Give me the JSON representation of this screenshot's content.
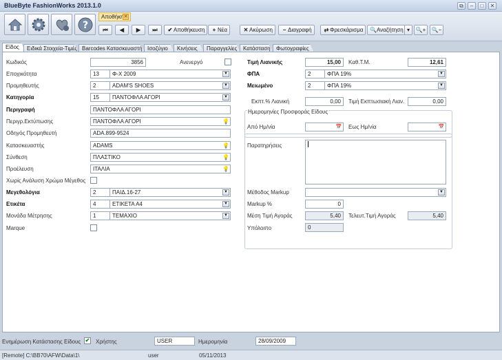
{
  "window": {
    "title": "BlueByte FashionWorks 2013.1.0"
  },
  "document_tab": {
    "label": "Αποθήκη"
  },
  "toolbar": {
    "save": "Αποθήκευση",
    "new": "Νέα",
    "cancel": "Ακύρωση",
    "delete": "Διαγραφή",
    "refresh": "Φρεσκάρισμα",
    "search": "Αναζήτηση"
  },
  "tabs": [
    "Είδος",
    "Ειδικά Στοιχεία-Τιμές",
    "Barcodes Κατασκευαστή",
    "Ισοζύγιο",
    "Κινήσεις",
    "Παραγγελίες",
    "Κατάσταση",
    "Φωτογραφίες"
  ],
  "form": {
    "code_label": "Κωδικός",
    "code": "3856",
    "inactive_label": "Ανενεργό",
    "season_label": "Εποχικότητα",
    "season_code": "13",
    "season_name": "Φ-Χ 2009",
    "supplier_label": "Προμηθευτής",
    "supplier_code": "2",
    "supplier_name": "ADAM'S SHOES",
    "category_label": "Κατηγορία",
    "category_code": "15",
    "category_name": "ΠΑΝΤΟΦΛΑ ΑΓΟΡΙ",
    "description_label": "Περιγραφή",
    "description": "ΠΑΝΤΟΦΛΑ ΑΓΟΡΙ",
    "print_desc_label": "Περιγρ.Εκτύπωσης",
    "print_desc": "ΠΑΝΤΟΦΛΑ ΑΓΟΡΙ",
    "supplier_code_label": "Οδηγός Προμηθευτή",
    "supplier_ref": "ADA.899-9524",
    "manufacturer_label": "Κατασκευαστής",
    "manufacturer": "ADAMS",
    "composition_label": "Σύνθεση",
    "composition": "ΠΛΑΣΤΙΚΟ",
    "origin_label": "Προέλευση",
    "origin": "ΙΤΑΛΙΑ",
    "no_color_size_label": "Χωρίς Ανάλυση Χρώμα Μέγεθος",
    "size_range_label": "Μεγεθολόγια",
    "size_range_code": "2",
    "size_range_name": "ΠΑΙΔ.16-27",
    "label_label": "Ετικέτα",
    "label_code": "4",
    "label_name": "ΕΤΙΚΕΤΑ Α4",
    "unit_label": "Μονάδα Μέτρησης",
    "unit_code": "1",
    "unit_name": "ΤΕΜΑΧΙΟ",
    "marque_label": "Marque",
    "retail_price_label": "Τιμή Λιανικής",
    "retail_price": "15,00",
    "net_cost_label": "Καθ.Τ.Μ.",
    "net_cost": "12,61",
    "vat_label": "ΦΠΑ",
    "vat_code": "2",
    "vat_name": "ΦΠΑ 19%",
    "reduced_label": "Μειωμένο",
    "reduced_code": "2",
    "reduced_name": "ΦΠΑ 19%",
    "discount_label": "Εκπτ.% Λιανική",
    "discount": "0,00",
    "discount_price_label": "Τιμή Εκπτωσιακή Λιαν.",
    "discount_price": "0,00",
    "offer_dates_label": "Ημερομηνίες Προσφοράς Είδους",
    "from_label": "Από Ημ/νία",
    "to_label": "Εως Ημ/νία",
    "notes_label": "Παρατηρήσεις",
    "markup_method_label": "Μέθοδος Markup",
    "markup_pct_label": "Markup %",
    "markup_pct": "0",
    "avg_cost_label": "Μέση Τιμή Αγοράς",
    "avg_cost": "5,40",
    "last_cost_label": "Τελευτ.Τιμή Αγοράς",
    "last_cost": "5,40",
    "balance_label": "Υπόλοιπο",
    "balance": "0"
  },
  "bottom": {
    "update_status_label": "Ενημέρωση Κατάστασης Είδους",
    "user_label": "Χρήστης",
    "user": "USER",
    "date_label": "Ημερομηνία",
    "date": "28/09/2009"
  },
  "status": {
    "path": "[Remote] C:\\BB70\\AFW\\Data\\1\\",
    "user": "user",
    "date": "05/11/2013"
  }
}
